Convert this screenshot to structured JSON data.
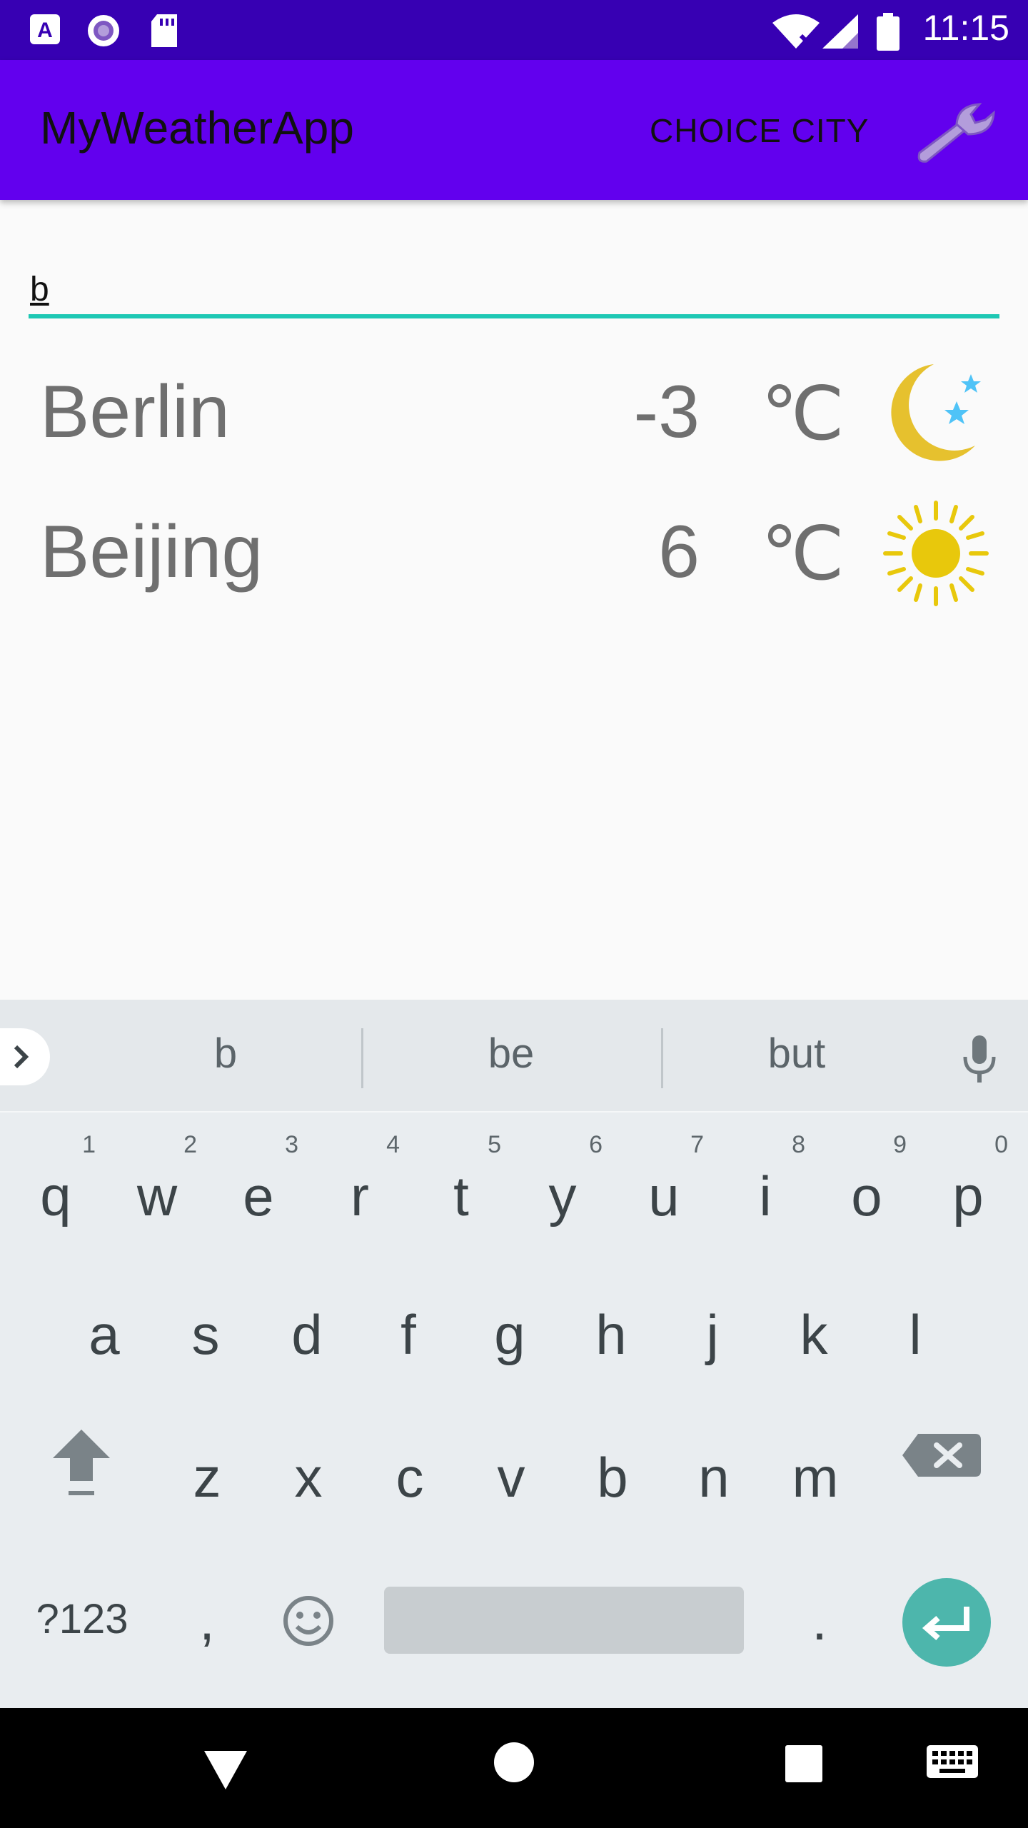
{
  "status_bar": {
    "time": "11:15",
    "left_icons": [
      "a-notification-icon",
      "radio-icon",
      "sd-card-icon"
    ],
    "right_icons": [
      "wifi-off-icon",
      "signal-icon",
      "battery-icon"
    ]
  },
  "app_bar": {
    "title": "MyWeatherApp",
    "action_label": "CHOICE CITY",
    "settings_icon": "wrench-icon",
    "background_color": "#6200ee"
  },
  "search": {
    "value": "b",
    "underline_color": "#1ec8b4"
  },
  "cities": [
    {
      "name": "Berlin",
      "temp": "-3",
      "unit": "℃",
      "icon": "moon-stars-icon"
    },
    {
      "name": "Beijing",
      "temp": "6",
      "unit": "℃",
      "icon": "sun-icon"
    }
  ],
  "keyboard": {
    "suggestions": [
      "b",
      "be",
      "but"
    ],
    "row1": [
      {
        "letter": "q",
        "hint": "1"
      },
      {
        "letter": "w",
        "hint": "2"
      },
      {
        "letter": "e",
        "hint": "3"
      },
      {
        "letter": "r",
        "hint": "4"
      },
      {
        "letter": "t",
        "hint": "5"
      },
      {
        "letter": "y",
        "hint": "6"
      },
      {
        "letter": "u",
        "hint": "7"
      },
      {
        "letter": "i",
        "hint": "8"
      },
      {
        "letter": "o",
        "hint": "9"
      },
      {
        "letter": "p",
        "hint": "0"
      }
    ],
    "row2": [
      "a",
      "s",
      "d",
      "f",
      "g",
      "h",
      "j",
      "k",
      "l"
    ],
    "row3": [
      "z",
      "x",
      "c",
      "v",
      "b",
      "n",
      "m"
    ],
    "symbols_label": "?123",
    "comma_label": ",",
    "period_label": ".",
    "accent_color": "#4db6ac"
  },
  "nav_bar": {
    "icons": [
      "back-icon",
      "home-icon",
      "recents-icon",
      "keyboard-switch-icon"
    ]
  }
}
